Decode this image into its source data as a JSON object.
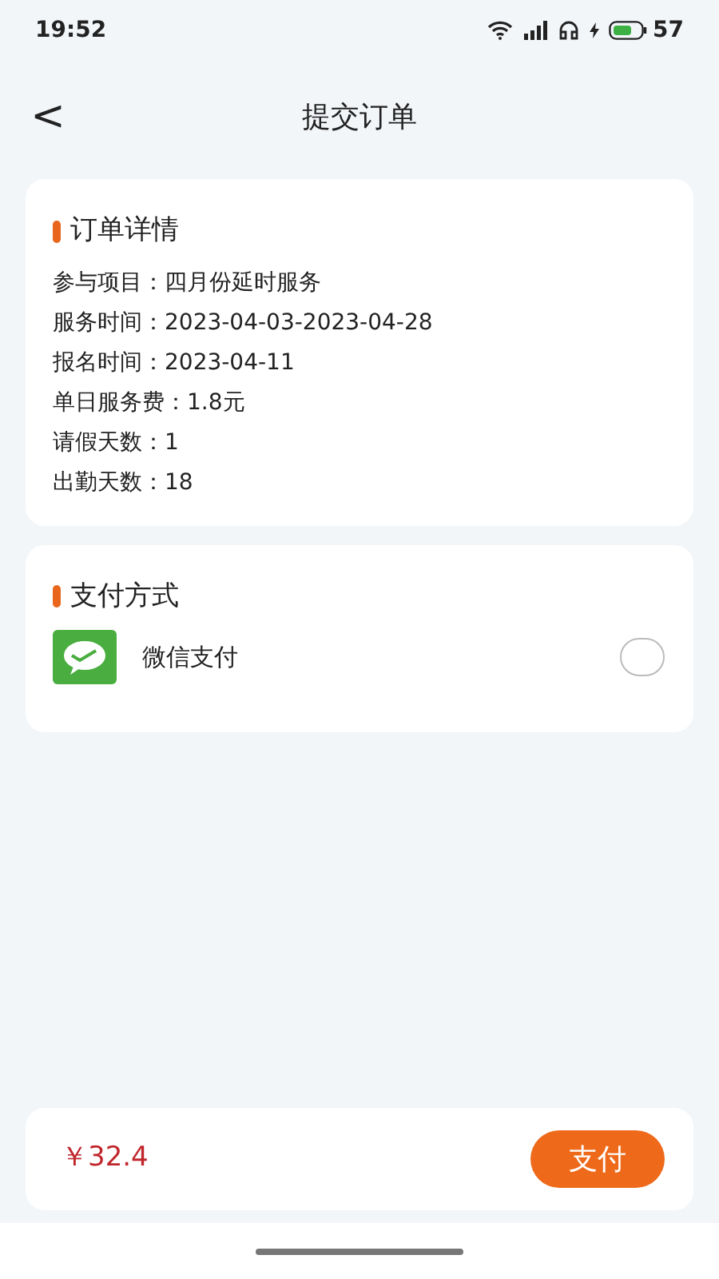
{
  "status_bar": {
    "time": "19:52",
    "battery": "57"
  },
  "header": {
    "back": "<",
    "title": "提交订单"
  },
  "order_details": {
    "title": "订单详情",
    "rows": [
      {
        "label": "参与项目：",
        "value": "四月份延时服务"
      },
      {
        "label": "服务时间：",
        "value": "2023-04-03-2023-04-28"
      },
      {
        "label": "报名时间：",
        "value": "2023-04-11"
      },
      {
        "label": "单日服务费：",
        "value": "1.8元"
      },
      {
        "label": "请假天数：",
        "value": "1"
      },
      {
        "label": "出勤天数：",
        "value": "18"
      }
    ]
  },
  "payment": {
    "title": "支付方式",
    "options": [
      {
        "label": "微信支付",
        "selected": false
      }
    ]
  },
  "footer": {
    "total": "￥32.4",
    "pay_button": "支付"
  }
}
